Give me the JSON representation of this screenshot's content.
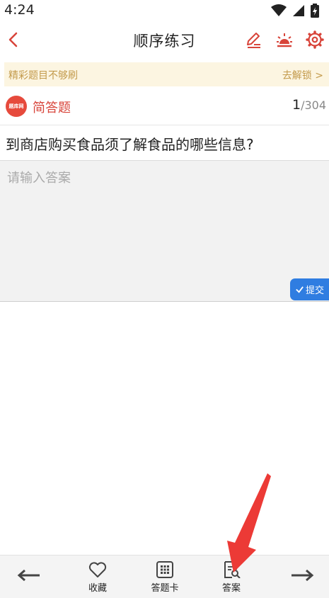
{
  "status": {
    "time": "4:24"
  },
  "nav": {
    "title": "顺序练习"
  },
  "promo": {
    "text": "精彩题目不够刷",
    "link": "去解锁 >"
  },
  "question_type": {
    "logo_text": "题库网",
    "label": "简答题",
    "current": "1",
    "total": "304"
  },
  "question": {
    "text": "到商店购买食品须了解食品的哪些信息?"
  },
  "answer": {
    "placeholder": "请输入答案",
    "value": ""
  },
  "submit": {
    "label": "提交"
  },
  "bottom_bar": {
    "favorite": "收藏",
    "answer_card": "答题卡",
    "answer": "答案"
  },
  "colors": {
    "accent_red": "#d8443a",
    "promo_bg": "#fcf5e1",
    "promo_text": "#c39a4b",
    "submit_blue": "#2f7de1"
  }
}
